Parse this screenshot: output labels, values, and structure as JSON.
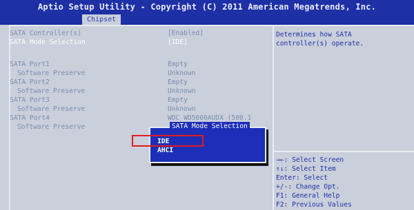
{
  "header": {
    "title": "Aptio Setup Utility - Copyright (C) 2011 American Megatrends, Inc.",
    "tab": "Chipset"
  },
  "settings": [
    {
      "label": "SATA Controller(s)",
      "value": "[Enabled]",
      "sub": false,
      "highlight": false
    },
    {
      "label": "SATA Mode Selection",
      "value": "[IDE]",
      "sub": false,
      "highlight": true
    },
    {
      "label": "SATA Port1",
      "value": "Empty",
      "sub": false,
      "highlight": false
    },
    {
      "label": "Software Preserve",
      "value": "Unknown",
      "sub": true,
      "highlight": false
    },
    {
      "label": "SATA Port2",
      "value": "Empty",
      "sub": false,
      "highlight": false
    },
    {
      "label": "Software Preserve",
      "value": "Unknown",
      "sub": true,
      "highlight": false
    },
    {
      "label": "SATA Port3",
      "value": "Empty",
      "sub": false,
      "highlight": false
    },
    {
      "label": "Software Preserve",
      "value": "Unknown",
      "sub": true,
      "highlight": false
    },
    {
      "label": "SATA Port4",
      "value": "WDC WD5000AUDX (500.1",
      "sub": false,
      "highlight": false
    },
    {
      "label": "Software Preserve",
      "value": "",
      "sub": true,
      "highlight": false
    }
  ],
  "help": {
    "text": "Determines how SATA\ncontroller(s) operate."
  },
  "keys": [
    "→←: Select Screen",
    "↑↓: Select Item",
    "Enter: Select",
    "+/-: Change Opt.",
    "F1: General Help",
    "F2: Previous Values"
  ],
  "popup": {
    "title": "SATA Mode Selection",
    "options": [
      "IDE",
      "AHCI"
    ]
  },
  "colors": {
    "header_bg": "#1e30a6",
    "panel_bg": "#c9cfdb",
    "popup_bg": "#1d2fb8",
    "callout": "#e11b1b"
  }
}
